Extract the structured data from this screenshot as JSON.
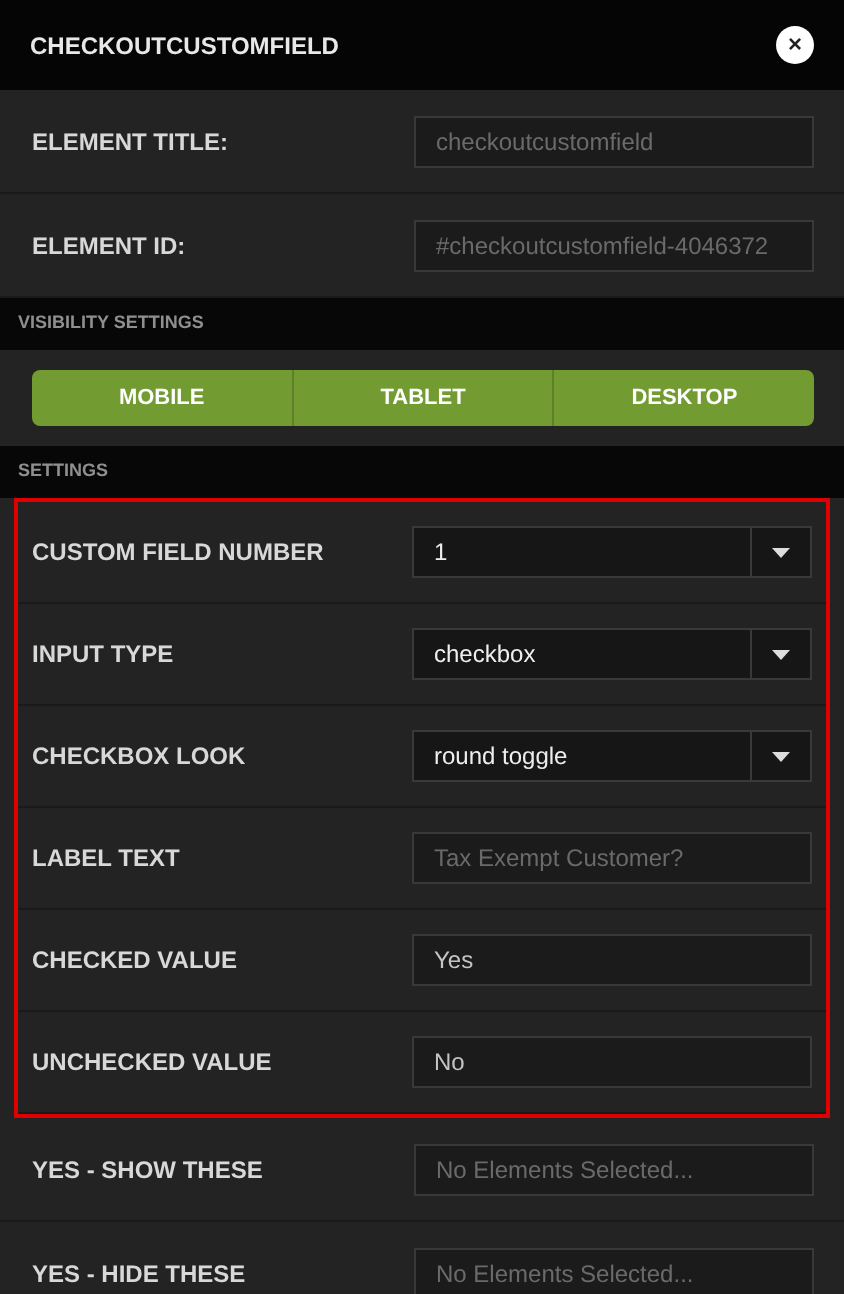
{
  "header": {
    "title": "CHECKOUTCUSTOMFIELD",
    "close": "×"
  },
  "general": [
    {
      "label": "ELEMENT TITLE:",
      "kind": "text",
      "placeholder": "checkoutcustomfield"
    },
    {
      "label": "ELEMENT ID:",
      "kind": "text",
      "placeholder": "#checkoutcustomfield-4046372"
    }
  ],
  "visibility": {
    "heading": "VISIBILITY SETTINGS",
    "devices": [
      {
        "label": "MOBILE",
        "selected": true
      },
      {
        "label": "TABLET",
        "selected": true
      },
      {
        "label": "DESKTOP",
        "selected": true
      }
    ]
  },
  "settings": {
    "heading": "SETTINGS",
    "rows": [
      {
        "label": "CUSTOM FIELD NUMBER",
        "kind": "select",
        "value": "1",
        "highlighted": true
      },
      {
        "label": "INPUT TYPE",
        "kind": "select",
        "value": "checkbox",
        "highlighted": true
      },
      {
        "label": "CHECKBOX LOOK",
        "kind": "select",
        "value": "round toggle",
        "highlighted": true
      },
      {
        "label": "LABEL TEXT",
        "kind": "text",
        "placeholder": "Tax Exempt Customer?",
        "highlighted": true
      },
      {
        "label": "CHECKED VALUE",
        "kind": "text",
        "value": "Yes",
        "highlighted": true
      },
      {
        "label": "UNCHECKED VALUE",
        "kind": "text",
        "value": "No",
        "highlighted": true
      },
      {
        "label": "YES - SHOW THESE",
        "kind": "text",
        "placeholder": "No Elements Selected...",
        "highlighted": false
      },
      {
        "label": "YES - HIDE THESE",
        "kind": "text",
        "placeholder": "No Elements Selected...",
        "highlighted": false
      }
    ]
  }
}
